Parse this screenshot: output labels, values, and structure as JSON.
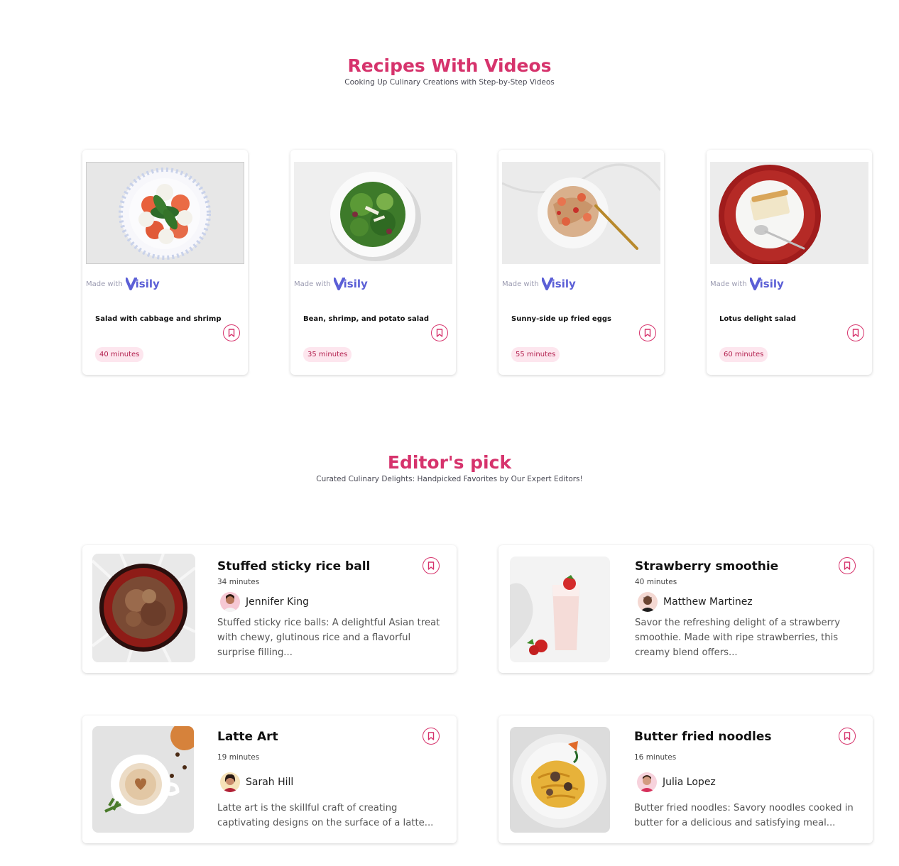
{
  "videos_section": {
    "title": "Recipes With Videos",
    "subtitle": "Cooking Up Culinary Creations with Step-by-Step Videos",
    "made_with_label": "Made with",
    "brand": "isily",
    "cards": [
      {
        "title": "Salad with cabbage and shrimp",
        "time": "40 minutes"
      },
      {
        "title": "Bean, shrimp, and potato salad",
        "time": "35 minutes"
      },
      {
        "title": "Sunny-side up fried eggs",
        "time": "55 minutes"
      },
      {
        "title": "Lotus delight salad",
        "time": "60 minutes"
      }
    ]
  },
  "editors_section": {
    "title": "Editor's pick",
    "subtitle": "Curated Culinary Delights: Handpicked Favorites by Our Expert Editors!",
    "cards": [
      {
        "title": "Stuffed sticky rice ball",
        "time": "34 minutes",
        "author": "Jennifer King",
        "description": "Stuffed sticky rice balls: A delightful Asian treat with chewy, glutinous rice and a flavorful surprise filling..."
      },
      {
        "title": "Strawberry smoothie",
        "time": "40 minutes",
        "author": "Matthew Martinez",
        "description": "Savor the refreshing delight of a strawberry smoothie. Made with ripe strawberries, this creamy blend offers..."
      },
      {
        "title": "Latte Art",
        "time": "19 minutes",
        "author": "Sarah Hill",
        "description": "Latte art is the skillful craft of creating captivating designs on the surface of a latte..."
      },
      {
        "title": "Butter fried noodles",
        "time": "16 minutes",
        "author": "Julia Lopez",
        "description": "Butter fried noodles: Savory noodles cooked in butter for a delicious and satisfying meal..."
      }
    ]
  },
  "icons": {
    "bookmark": "bookmark-icon",
    "brand_logo": "visily-logo-icon"
  },
  "colors": {
    "accent": "#d6336c",
    "pill_bg": "#fde6ee",
    "brand": "#5b5fd6"
  }
}
